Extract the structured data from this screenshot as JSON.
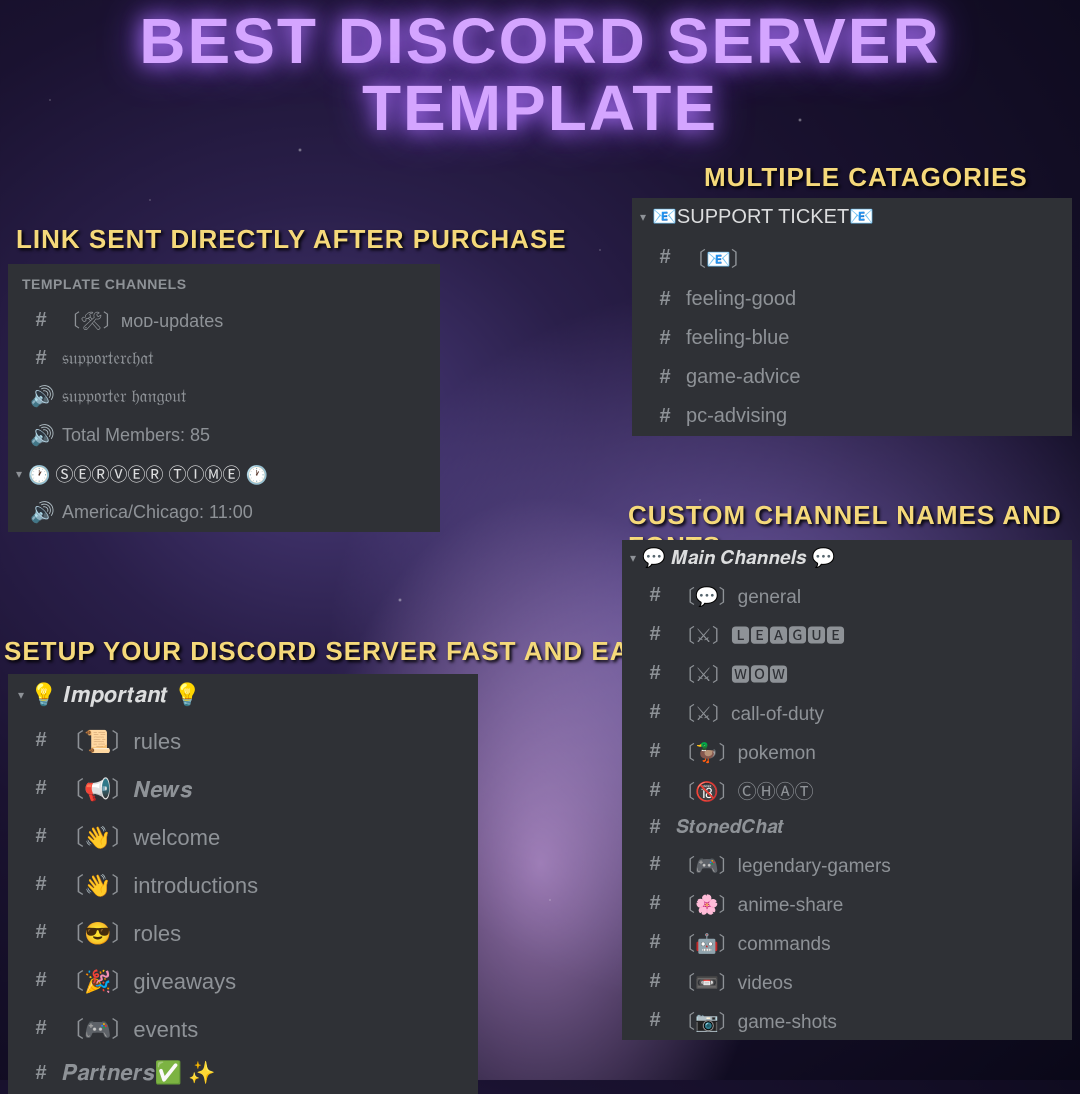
{
  "title_line1": "BEST DISCORD SERVER",
  "title_line2": "TEMPLATE",
  "captions": {
    "link_sent": "LINK SENT DIRECTLY AFTER PURCHASE",
    "setup_fast": "SETUP YOUR DISCORD SERVER FAST AND EASY",
    "multiple_categories": "MULTIPLE CATAGORIES",
    "custom_names": "CUSTOM CHANNEL NAMES AND FONTS"
  },
  "panel_template": {
    "header": "TEMPLATE CHANNELS",
    "channels": [
      {
        "type": "text",
        "label": "〔🛠〕ᴍᴏᴅ-updates"
      },
      {
        "type": "text",
        "label": "𝔰𝔲𝔭𝔭𝔬𝔯𝔱𝔢𝔯𝔠𝔥𝔞𝔱"
      },
      {
        "type": "voice",
        "label": "𝔰𝔲𝔭𝔭𝔬𝔯𝔱𝔢𝔯 𝔥𝔞𝔫𝔤𝔬𝔲𝔱"
      },
      {
        "type": "voice",
        "label": "Total Members: 85"
      }
    ],
    "category": "🕐 ⓈⒺⓇⓋⒺⓇ ⓉⒾⓂⒺ 🕐",
    "category_channels": [
      {
        "type": "voice",
        "label": "America/Chicago: 11:00"
      }
    ]
  },
  "panel_important": {
    "category": "💡 𝑰𝒎𝒑𝒐𝒓𝒕𝒂𝒏𝒕 💡",
    "channels": [
      {
        "label": "〔📜〕rules"
      },
      {
        "label": "〔📢〕𝑵𝒆𝒘𝒔"
      },
      {
        "label": "〔👋〕welcome"
      },
      {
        "label": "〔👋〕introductions"
      },
      {
        "label": "〔😎〕roles"
      },
      {
        "label": "〔🎉〕giveaways"
      },
      {
        "label": "〔🎮〕events"
      },
      {
        "label": "𝑷𝒂𝒓𝒕𝒏𝒆𝒓𝒔✅ ✨"
      }
    ]
  },
  "panel_support": {
    "category": "📧SUPPORT TICKET📧",
    "channels": [
      {
        "label": "〔📧〕"
      },
      {
        "label": "feeling-good"
      },
      {
        "label": "feeling-blue"
      },
      {
        "label": "game-advice"
      },
      {
        "label": "pc-advising"
      }
    ]
  },
  "panel_main": {
    "category": "💬 𝑴𝒂𝒊𝒏 𝑪𝒉𝒂𝒏𝒏𝒆𝒍𝒔 💬",
    "channels": [
      {
        "label": "〔💬〕general"
      },
      {
        "label": "〔⚔〕🅻🅴🅰🅶🆄🅴"
      },
      {
        "label": "〔⚔〕🆆🅾🆆"
      },
      {
        "label": "〔⚔〕call-of-duty"
      },
      {
        "label": "〔🦆〕pokemon"
      },
      {
        "label": "〔🔞〕ⒸⒽⒶⓉ"
      },
      {
        "label": "𝑺𝒕𝒐𝒏𝒆𝒅𝑪𝒉𝒂𝒕"
      },
      {
        "label": "〔🎮〕legendary-gamers"
      },
      {
        "label": "〔🌸〕anime-share"
      },
      {
        "label": "〔🤖〕commands"
      },
      {
        "label": "〔📼〕videos"
      },
      {
        "label": "〔📷〕game-shots"
      }
    ]
  }
}
